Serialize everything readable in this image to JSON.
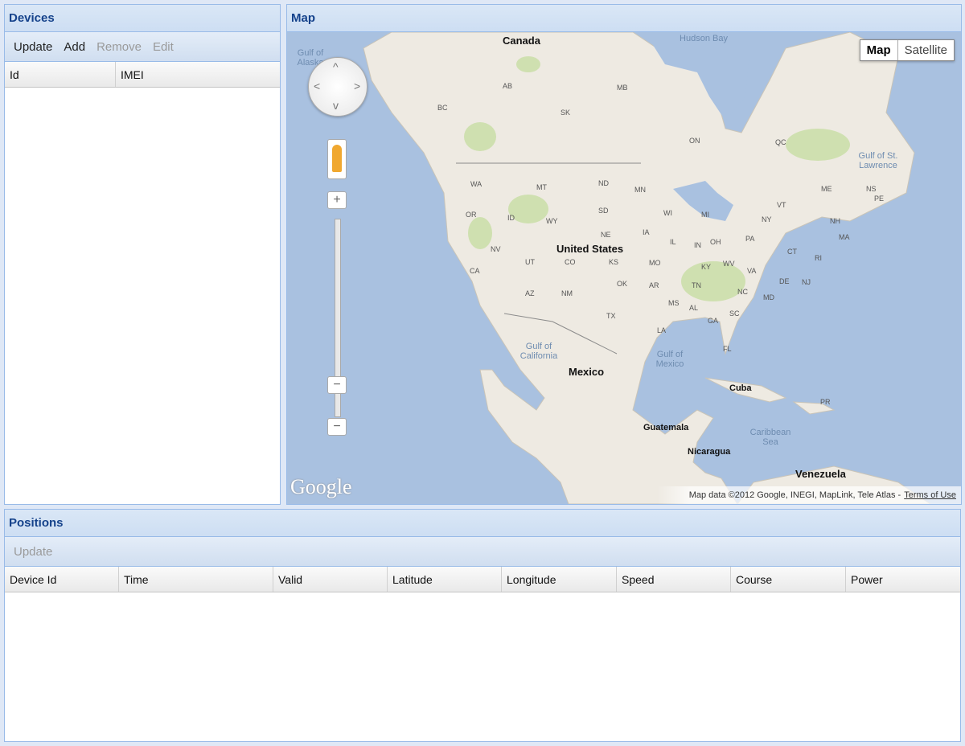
{
  "devices": {
    "title": "Devices",
    "toolbar": {
      "update": "Update",
      "add": "Add",
      "remove": "Remove",
      "edit": "Edit"
    },
    "columns": [
      "Id",
      "IMEI"
    ]
  },
  "map": {
    "title": "Map",
    "type_buttons": {
      "map": "Map",
      "satellite": "Satellite"
    },
    "controls": {
      "pan_up": "^",
      "pan_down": "v",
      "pan_left": "<",
      "pan_right": ">",
      "zoom_in": "+",
      "zoom_out": "−",
      "zoom_out_2": "−"
    },
    "watermark": "Google",
    "copyright": "Map data ©2012 Google, INEGI, MapLink, Tele Atlas -",
    "terms": "Terms of Use",
    "labels": {
      "canada": "Canada",
      "united_states": "United States",
      "mexico": "Mexico",
      "cuba": "Cuba",
      "guatemala": "Guatemala",
      "nicaragua": "Nicaragua",
      "venezuela": "Venezuela",
      "hudson_bay": "Hudson Bay",
      "gulf_alaska": "Gulf of Alaska",
      "gulf_mexico": "Gulf of Mexico",
      "gulf_california": "Gulf of California",
      "caribbean": "Caribbean Sea",
      "gulf_stlawrence": "Gulf of St. Lawrence",
      "states": [
        "AB",
        "SK",
        "MB",
        "BC",
        "ON",
        "QC",
        "WA",
        "MT",
        "ND",
        "MN",
        "OR",
        "ID",
        "WY",
        "SD",
        "NV",
        "UT",
        "CO",
        "NE",
        "KS",
        "CA",
        "AZ",
        "NM",
        "OK",
        "TX",
        "IA",
        "IL",
        "MO",
        "AR",
        "LA",
        "MS",
        "AL",
        "GA",
        "FL",
        "TN",
        "KY",
        "IN",
        "OH",
        "MI",
        "WI",
        "PA",
        "NY",
        "VT",
        "NH",
        "ME",
        "MA",
        "RI",
        "CT",
        "NJ",
        "DE",
        "MD",
        "VA",
        "WV",
        "NC",
        "SC",
        "NS",
        "PE",
        "PR"
      ]
    },
    "colors": {
      "water": "#a9c1e0",
      "land": "#eeeae2",
      "park": "#cfe0b0"
    }
  },
  "positions": {
    "title": "Positions",
    "toolbar": {
      "update": "Update"
    },
    "columns": [
      "Device Id",
      "Time",
      "Valid",
      "Latitude",
      "Longitude",
      "Speed",
      "Course",
      "Power"
    ]
  }
}
